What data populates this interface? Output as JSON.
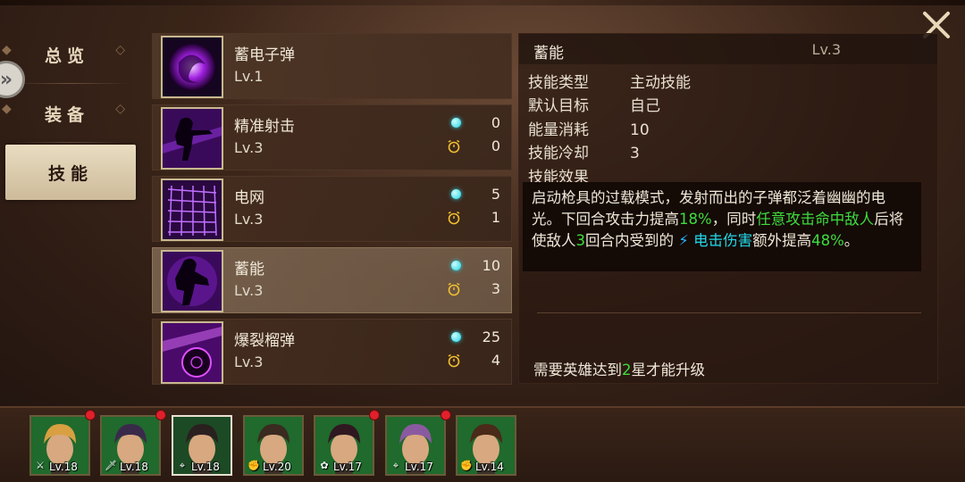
{
  "nav": {
    "items": [
      {
        "label": "总览",
        "active": false
      },
      {
        "label": "装备",
        "active": false
      },
      {
        "label": "技能",
        "active": true
      }
    ]
  },
  "skills": [
    {
      "name": "蓄电子弹",
      "level": "Lv.1",
      "energy": null,
      "cooldown": null,
      "color": "#9a2ad8"
    },
    {
      "name": "精准射击",
      "level": "Lv.3",
      "energy": "0",
      "cooldown": "0",
      "color": "#8a20c8"
    },
    {
      "name": "电网",
      "level": "Lv.3",
      "energy": "5",
      "cooldown": "1",
      "color": "#7a28d0"
    },
    {
      "name": "蓄能",
      "level": "Lv.3",
      "energy": "10",
      "cooldown": "3",
      "color": "#8a20c8",
      "selected": true
    },
    {
      "name": "爆裂榴弹",
      "level": "Lv.3",
      "energy": "25",
      "cooldown": "4",
      "color": "#b030d8"
    }
  ],
  "detail": {
    "title": "蓄能",
    "level": "Lv.3",
    "rows": [
      {
        "key": "技能类型",
        "value": "主动技能"
      },
      {
        "key": "默认目标",
        "value": "自己"
      },
      {
        "key": "能量消耗",
        "value": "10"
      },
      {
        "key": "技能冷却",
        "value": "3"
      },
      {
        "key": "技能效果",
        "value": ""
      }
    ],
    "desc": {
      "p1": "启动枪具的过载模式，发射而出的子弹都泛着幽幽的电光。下回合攻击力提高",
      "pct1": "18%",
      "p2": "，同时",
      "hl1": "任意攻击命中敌人",
      "p3": "后将使敌人",
      "num": "3",
      "p4": "回合内受到的 ",
      "bolt": "⚡",
      "hl2": "电击伤害",
      "p5": "额外提高",
      "pct2": "48%",
      "p6": "。"
    },
    "upgrade": {
      "pre": "需要英雄达到",
      "num": "2",
      "post": "星才能升级"
    }
  },
  "heroes": [
    {
      "level": "Lv.18",
      "class_icon": "sword-icon",
      "glyph": "⚔",
      "badge": true,
      "selected": false,
      "hair": "#d8a040"
    },
    {
      "level": "Lv.18",
      "class_icon": "dagger-icon",
      "glyph": "🗡",
      "badge": true,
      "selected": false,
      "hair": "#3a2a4a"
    },
    {
      "level": "Lv.18",
      "class_icon": "crosshair-icon",
      "glyph": "⌖",
      "badge": false,
      "selected": true,
      "hair": "#2a2020"
    },
    {
      "level": "Lv.20",
      "class_icon": "fist-icon",
      "glyph": "✊",
      "badge": false,
      "selected": false,
      "hair": "#3a2a20"
    },
    {
      "level": "Lv.17",
      "class_icon": "lotus-icon",
      "glyph": "✿",
      "badge": true,
      "selected": false,
      "hair": "#301820"
    },
    {
      "level": "Lv.17",
      "class_icon": "crosshair-icon",
      "glyph": "⌖",
      "badge": true,
      "selected": false,
      "hair": "#8a5aa0"
    },
    {
      "level": "Lv.14",
      "class_icon": "fist-icon",
      "glyph": "✊",
      "badge": false,
      "selected": false,
      "hair": "#4a2a18"
    }
  ]
}
